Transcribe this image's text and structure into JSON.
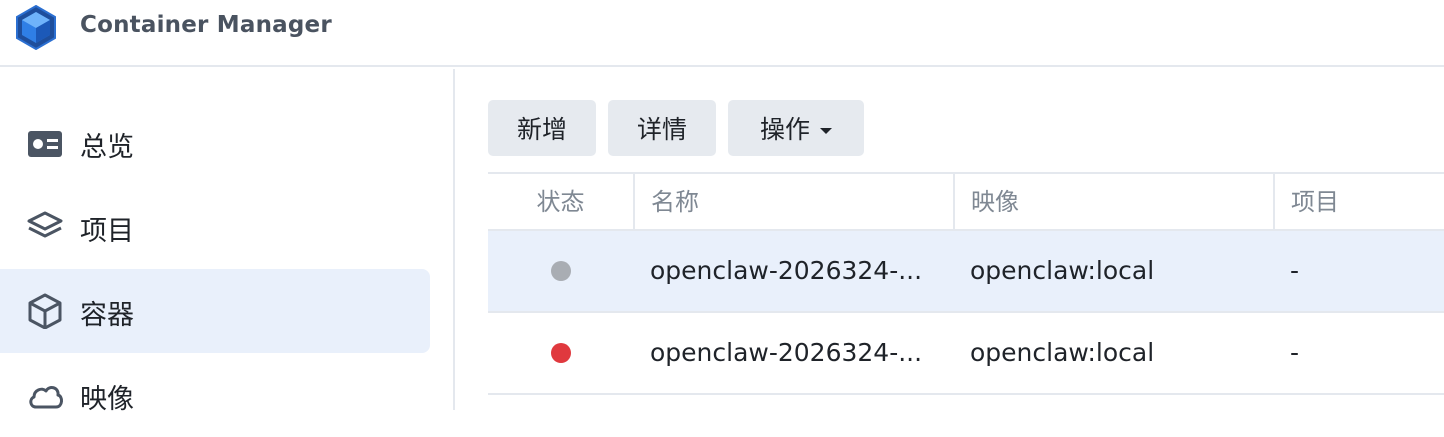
{
  "app": {
    "title": "Container Manager"
  },
  "sidebar": {
    "items": [
      {
        "label": "总览",
        "icon": "overview-card-icon",
        "active": false
      },
      {
        "label": "项目",
        "icon": "layers-icon",
        "active": false
      },
      {
        "label": "容器",
        "icon": "cube-icon",
        "active": true
      },
      {
        "label": "映像",
        "icon": "cloud-icon",
        "active": false
      }
    ]
  },
  "toolbar": {
    "add_label": "新增",
    "details_label": "详情",
    "actions_label": "操作"
  },
  "table": {
    "columns": [
      "状态",
      "名称",
      "映像",
      "项目"
    ],
    "rows": [
      {
        "status": "stopped",
        "status_color": "#a9adb3",
        "name": "openclaw-2026324-...",
        "image": "openclaw:local",
        "project": "-"
      },
      {
        "status": "error",
        "status_color": "#e0393e",
        "name": "openclaw-2026324-...",
        "image": "openclaw:local",
        "project": "-"
      }
    ]
  },
  "colors": {
    "accent_bg": "#e9f0fb",
    "button_bg": "#e6eaef",
    "border": "#e4e8ee"
  }
}
